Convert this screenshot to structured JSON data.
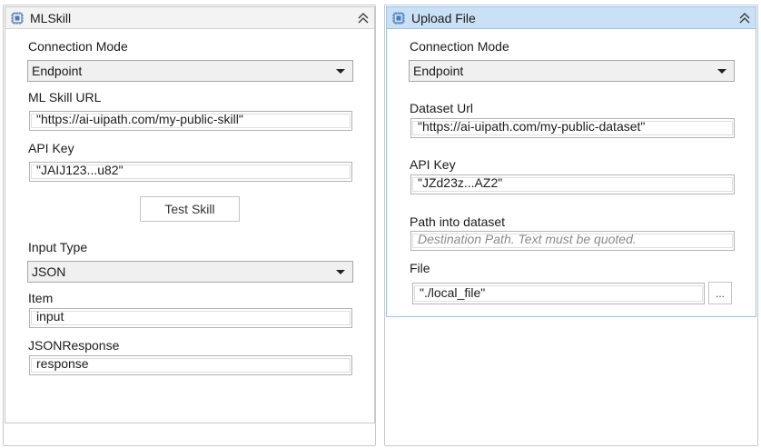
{
  "left": {
    "title": "MLSkill",
    "connection_mode_label": "Connection Mode",
    "connection_mode_value": "Endpoint",
    "ml_skill_url_label": "ML Skill URL",
    "ml_skill_url_value": "\"https://ai-uipath.com/my-public-skill\"",
    "api_key_label": "API Key",
    "api_key_value": "\"JAIJ123...u82\"",
    "test_button": "Test Skill",
    "input_type_label": "Input Type",
    "input_type_value": "JSON",
    "item_label": "Item",
    "item_value": "input",
    "json_response_label": "JSONResponse",
    "json_response_value": "response"
  },
  "right": {
    "title": "Upload File",
    "connection_mode_label": "Connection Mode",
    "connection_mode_value": "Endpoint",
    "dataset_url_label": "Dataset Url",
    "dataset_url_value": "\"https://ai-uipath.com/my-public-dataset\"",
    "api_key_label": "API Key",
    "api_key_value": "\"JZd23z...AZ2\"",
    "path_label": "Path into dataset",
    "path_placeholder": "Destination Path. Text must be quoted.",
    "file_label": "File",
    "file_value": "\"./local_file\"",
    "browse_button": "..."
  }
}
